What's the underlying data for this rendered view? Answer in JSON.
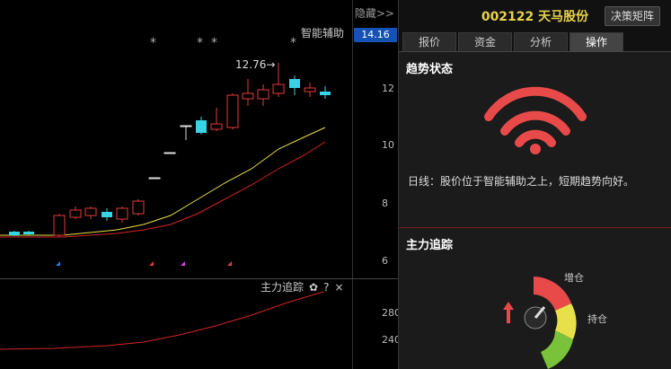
{
  "chart": {
    "hide_label": "隐藏>>",
    "overlay_label": "智能辅助",
    "current_price": "14.16",
    "peak_annotation": "12.76→",
    "y_ticks": [
      "12",
      "10",
      "8",
      "6"
    ],
    "sub_label": "主力追踪",
    "sub_ticks": [
      "280",
      "240"
    ],
    "gear_icon": "✿",
    "help_icon": "?",
    "close_icon": "×"
  },
  "panel": {
    "stock_title": "002122 天马股份",
    "decision_button": "决策矩阵",
    "tabs": [
      {
        "label": "报价"
      },
      {
        "label": "资金"
      },
      {
        "label": "分析"
      },
      {
        "label": "操作"
      }
    ],
    "trend_title": "趋势状态",
    "trend_desc": "日线：股价位于智能辅助之上，短期趋势向好。",
    "force_title": "主力追踪",
    "gauge_labels": {
      "up": "增仓",
      "hold": "持仓"
    }
  },
  "colors": {
    "rise": "#e23b3b",
    "fall": "#39d3e6",
    "accent": "#e8d24a",
    "wifi": "#e84a4a"
  }
}
